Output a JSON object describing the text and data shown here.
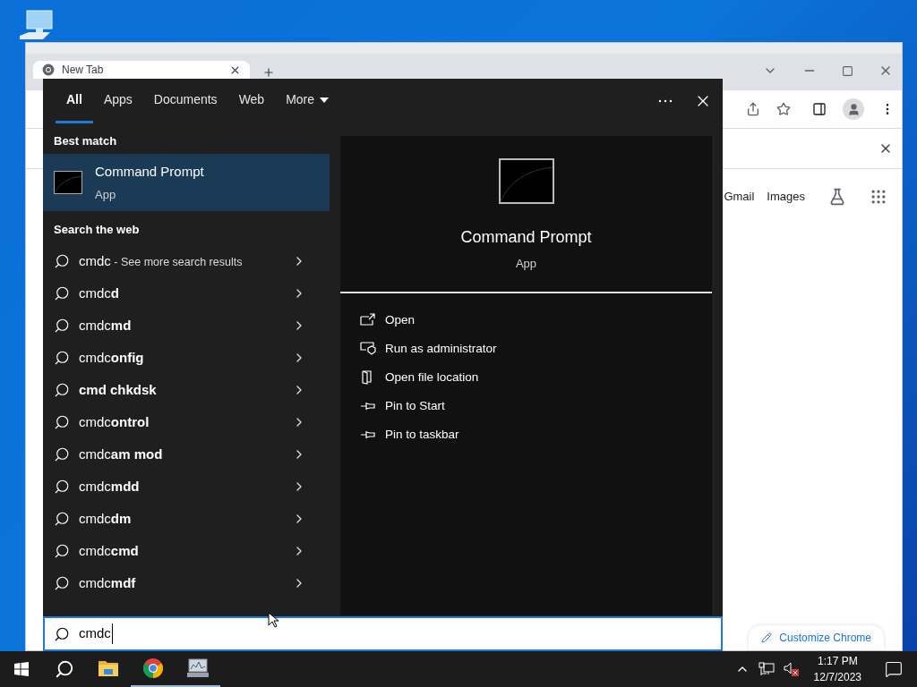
{
  "browser": {
    "tab": {
      "title": "New Tab"
    },
    "links": [
      "Gmail",
      "Images"
    ],
    "customize_label": "Customize Chrome"
  },
  "search_panel": {
    "tabs": [
      {
        "label": "All",
        "selected": true
      },
      {
        "label": "Apps",
        "selected": false
      },
      {
        "label": "Documents",
        "selected": false
      },
      {
        "label": "Web",
        "selected": false
      },
      {
        "label": "More",
        "selected": false
      }
    ],
    "best_match_heading": "Best match",
    "best_match": {
      "title": "Command Prompt",
      "subtitle": "App",
      "selected": true
    },
    "web_heading": "Search the web",
    "web_results": [
      {
        "text": "cmdc",
        "hint": "- See more search results"
      },
      {
        "text": "cmdc**d**"
      },
      {
        "text": "cmdc**md**"
      },
      {
        "text": "cmdc**onfig**"
      },
      {
        "text": "cmd chkdsk",
        "bold": true
      },
      {
        "text": "cmdc**ontrol**"
      },
      {
        "text": "cmdc**am mod**"
      },
      {
        "text": "cmdc**mdd**"
      },
      {
        "text": "cmdc**dm**"
      },
      {
        "text": "cmdc**cmd**"
      },
      {
        "text": "cmdc**mdf**"
      }
    ],
    "preview": {
      "title": "Command Prompt",
      "subtitle": "App",
      "actions": [
        {
          "kind": "open",
          "label": "Open"
        },
        {
          "kind": "admin",
          "label": "Run as administrator"
        },
        {
          "kind": "folder",
          "label": "Open file location"
        },
        {
          "kind": "pin",
          "label": "Pin to Start"
        },
        {
          "kind": "pin",
          "label": "Pin to taskbar"
        }
      ]
    },
    "search_box": {
      "value": "cmdc"
    }
  },
  "taskbar": {
    "apps": [
      {
        "kind": "explorer",
        "running": false
      },
      {
        "kind": "chrome",
        "running": true
      },
      {
        "kind": "monitor",
        "running": true
      }
    ],
    "clock": {
      "time": "1:17 PM",
      "date": "12/7/2023"
    }
  }
}
